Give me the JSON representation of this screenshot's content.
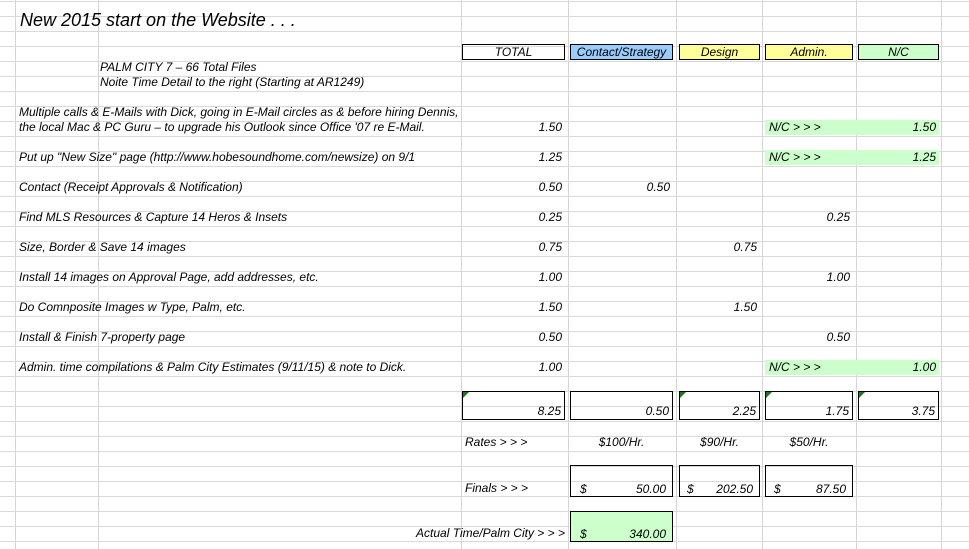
{
  "title": "New 2015 start on the Website . . .",
  "headers": {
    "total": "TOTAL",
    "contact": "Contact/Strategy",
    "design": "Design",
    "admin": "Admin.",
    "nc": "N/C"
  },
  "subtitle": {
    "line1": "PALM CITY 7 – 66 Total Files",
    "line2": "Noite Time Detail to the right (Starting at AR1249)"
  },
  "rows": [
    {
      "desc1": "Multiple calls & E-Mails with Dick, going in E-Mail circles as & before hiring Dennis,",
      "desc": "the local Mac & PC Guru – to upgrade his Outlook since Office '07 re E-Mail.",
      "total": "1.50",
      "contact": "",
      "design": "",
      "admin": "N/C > > >",
      "nc": "1.50"
    },
    {
      "desc": "Put up \"New Size\" page (http://www.hobesoundhome.com/newsize) on 9/1",
      "total": "1.25",
      "contact": "",
      "design": "",
      "admin": "N/C > > >",
      "nc": "1.25"
    },
    {
      "desc": "Contact (Receipt Approvals & Notification)",
      "total": "0.50",
      "contact": "0.50",
      "design": "",
      "admin": "",
      "nc": ""
    },
    {
      "desc": "Find MLS Resources & Capture 14 Heros & Insets",
      "total": "0.25",
      "contact": "",
      "design": "",
      "admin": "0.25",
      "nc": ""
    },
    {
      "desc": "Size, Border & Save 14 images",
      "total": "0.75",
      "contact": "",
      "design": "0.75",
      "admin": "",
      "nc": ""
    },
    {
      "desc": "Install 14 images on Approval Page, add addresses, etc.",
      "total": "1.00",
      "contact": "",
      "design": "",
      "admin": "1.00",
      "nc": ""
    },
    {
      "desc": "Do Comnposite Images w Type, Palm, etc.",
      "total": "1.50",
      "contact": "",
      "design": "1.50",
      "admin": "",
      "nc": ""
    },
    {
      "desc": "Install & Finish 7-property page",
      "total": "0.50",
      "contact": "",
      "design": "",
      "admin": "0.50",
      "nc": ""
    },
    {
      "desc": "Admin. time compilations & Palm City Estimates (9/11/15) & note to Dick.",
      "total": "1.00",
      "contact": "",
      "design": "",
      "admin": "N/C > > >",
      "nc": "1.00"
    }
  ],
  "sums": {
    "total": "8.25",
    "contact": "0.50",
    "design": "2.25",
    "admin": "1.75",
    "nc": "3.75"
  },
  "rates": {
    "label": "Rates > > >",
    "contact": "$100/Hr.",
    "design": "$90/Hr.",
    "admin": "$50/Hr."
  },
  "finals": {
    "label": "Finals > > >",
    "currency": "$",
    "contact": "50.00",
    "design": "202.50",
    "admin": "87.50"
  },
  "actual": {
    "label": "Actual Time/Palm City > > >",
    "currency": "$",
    "value": "340.00"
  }
}
